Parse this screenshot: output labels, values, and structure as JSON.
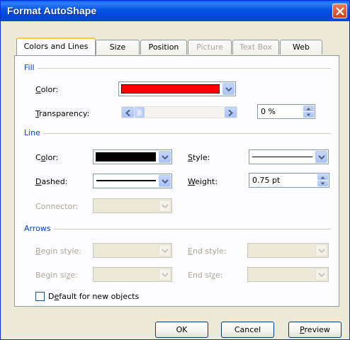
{
  "window": {
    "title": "Format AutoShape"
  },
  "tabs": [
    {
      "label": "Colors and Lines",
      "active": true,
      "disabled": false
    },
    {
      "label": "Size",
      "active": false,
      "disabled": false
    },
    {
      "label": "Position",
      "active": false,
      "disabled": false
    },
    {
      "label": "Picture",
      "active": false,
      "disabled": true
    },
    {
      "label": "Text Box",
      "active": false,
      "disabled": true
    },
    {
      "label": "Web",
      "active": false,
      "disabled": false
    }
  ],
  "fill": {
    "section": "Fill",
    "color_label": "Color:",
    "color_value": "#ff0000",
    "transparency_label": "Transparency:",
    "transparency_value": "0 %"
  },
  "line": {
    "section": "Line",
    "color_label": "Color:",
    "color_value": "#000000",
    "style_label": "Style:",
    "dashed_label": "Dashed:",
    "weight_label": "Weight:",
    "weight_value": "0.75 pt",
    "connector_label": "Connector:"
  },
  "arrows": {
    "section": "Arrows",
    "begin_style_label": "Begin style:",
    "end_style_label": "End style:",
    "begin_size_label": "Begin size:",
    "end_size_label": "End size:"
  },
  "default_checkbox": {
    "label": "Default for new objects",
    "checked": false
  },
  "buttons": {
    "ok": "OK",
    "cancel": "Cancel",
    "preview": "Preview"
  }
}
